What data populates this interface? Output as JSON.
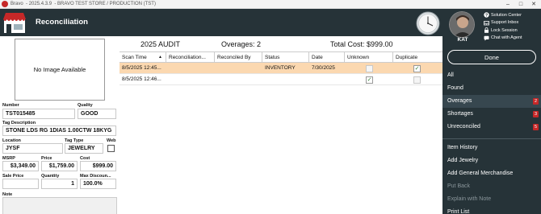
{
  "titlebar": {
    "app": "Bravo",
    "version": "2025.4.3.9",
    "location": "BRAVO TEST STORE / PRODUCTION (TST)",
    "minimize": "–",
    "maximize": "□",
    "close": "✕"
  },
  "header": {
    "title": "Reconciliation"
  },
  "user": {
    "name": "KAT",
    "links": [
      {
        "label": "Solution Center",
        "icon": "question-circle-icon"
      },
      {
        "label": "Support Inbox",
        "icon": "inbox-icon"
      },
      {
        "label": "Lock Session",
        "icon": "lock-icon"
      },
      {
        "label": "Chat with Agent",
        "icon": "chat-icon"
      }
    ]
  },
  "done_label": "Done",
  "filters": [
    {
      "label": "All",
      "count": "",
      "selected": false
    },
    {
      "label": "Found",
      "count": "",
      "selected": false
    },
    {
      "label": "Overages",
      "count": "2",
      "selected": true
    },
    {
      "label": "Shortages",
      "count": "3",
      "selected": false
    },
    {
      "label": "Unreconciled",
      "count": "5",
      "selected": false
    }
  ],
  "actions": [
    {
      "label": "Item History",
      "enabled": true
    },
    {
      "label": "Add Jewelry",
      "enabled": true
    },
    {
      "label": "Add General Merchandise",
      "enabled": true
    },
    {
      "label": "Put Back",
      "enabled": false
    },
    {
      "label": "Explain with Note",
      "enabled": false
    },
    {
      "label": "Print List",
      "enabled": true
    }
  ],
  "detail": {
    "image_placeholder": "No Image Available",
    "number_label": "Number",
    "number": "TST015485",
    "quality_label": "Quality",
    "quality": "GOOD",
    "tag_description_label": "Tag Description",
    "tag_description": "STONE LDS RG 1DIAS 1.00CTW 18KYG",
    "location_label": "Location",
    "location": "JYSF",
    "tag_type_label": "Tag Type",
    "tag_type": "JEWELRY",
    "web_label": "Web",
    "web_checked": false,
    "msrp_label": "MSRP",
    "msrp": "$3,349.00",
    "price_label": "Price",
    "price": "$1,759.00",
    "cost_label": "Cost",
    "cost": "$999.00",
    "sale_price_label": "Sale Price",
    "sale_price": "",
    "quantity_label": "Quantity",
    "quantity": "1",
    "max_discount_label": "Max Discoun...",
    "max_discount": "100.0%",
    "note_label": "Note",
    "note": ""
  },
  "summary": {
    "audit": "2025 AUDIT",
    "overages": "Overages: 2",
    "total_cost": "Total Cost: $999.00"
  },
  "grid": {
    "columns": [
      "Scan Time",
      "Reconciliation...",
      "Reconciled By",
      "Status",
      "Date",
      "Unknown",
      "Duplicate"
    ],
    "rows": [
      {
        "scan_time": "8/5/2025 12:45...",
        "reconciliation": "",
        "reconciled_by": "",
        "status": "INVENTORY",
        "date": "7/30/2025",
        "unknown": false,
        "duplicate": true,
        "selected": true
      },
      {
        "scan_time": "8/5/2025 12:46...",
        "reconciliation": "",
        "reconciled_by": "",
        "status": "",
        "date": "",
        "unknown": true,
        "duplicate": false,
        "selected": false
      }
    ]
  }
}
